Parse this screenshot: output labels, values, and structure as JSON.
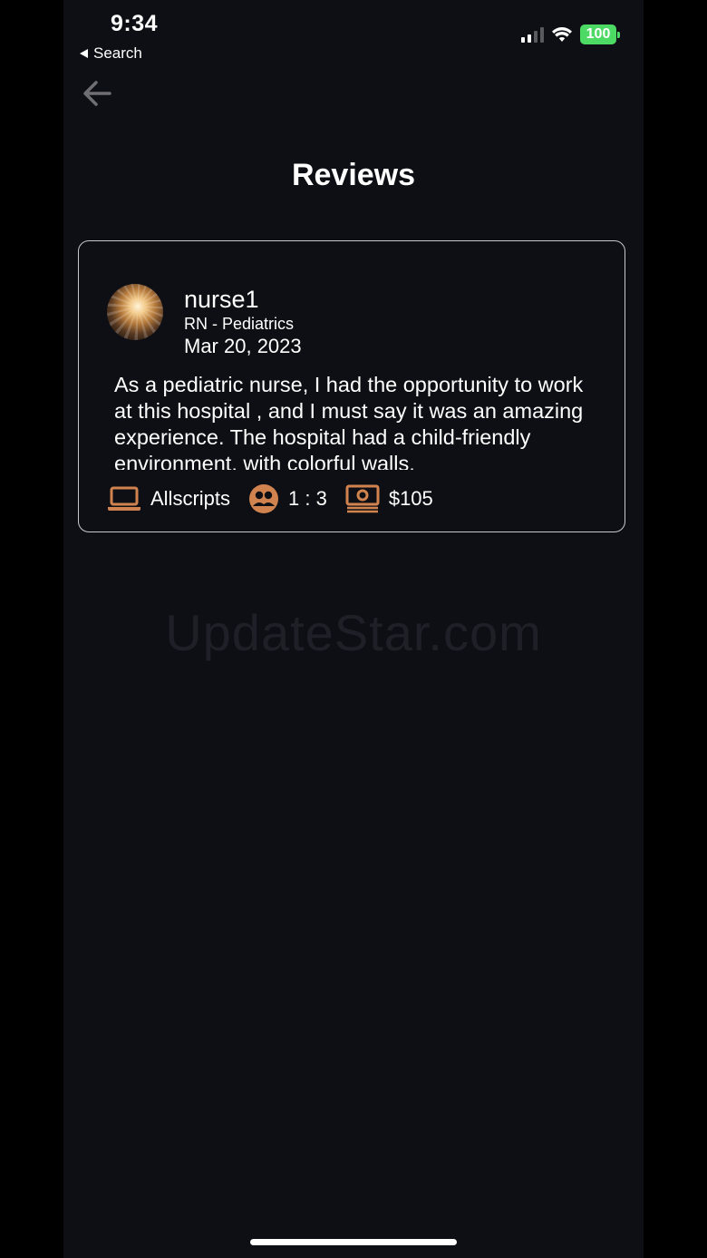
{
  "status_bar": {
    "time": "9:34",
    "back_app": "Search",
    "battery": "100",
    "battery_color": "#4cd964"
  },
  "nav": {
    "back_icon": "arrow-left-icon"
  },
  "page": {
    "title": "Reviews"
  },
  "review": {
    "username": "nurse1",
    "role": "RN - Pediatrics",
    "date": "Mar 20, 2023",
    "text": "As a pediatric nurse, I had the opportunity to work at this hospital , and I must say it was an amazing experience. The hospital had a child-friendly environment, with colorful walls,",
    "ehr": "Allscripts",
    "ratio": "1 : 3",
    "pay": "$105",
    "icons": [
      "laptop-icon",
      "patients-icon",
      "money-icon"
    ],
    "accent_color": "#d1834f"
  },
  "watermark": "UpdateStar.com"
}
